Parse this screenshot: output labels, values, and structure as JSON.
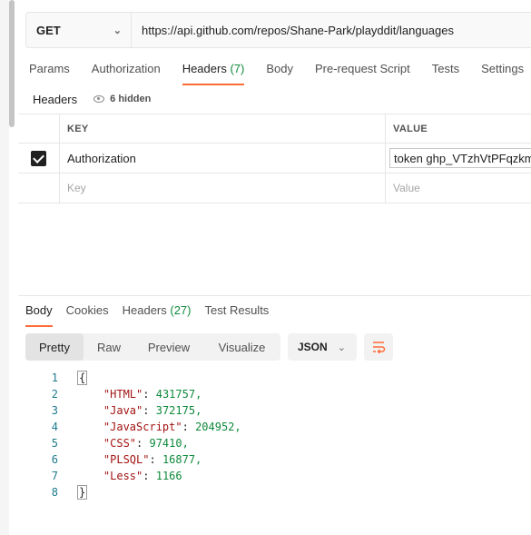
{
  "request": {
    "method": "GET",
    "url": "https://api.github.com/repos/Shane-Park/playddit/languages"
  },
  "request_tabs": [
    {
      "label": "Params"
    },
    {
      "label": "Authorization"
    },
    {
      "label": "Headers",
      "count": "(7)"
    },
    {
      "label": "Body"
    },
    {
      "label": "Pre-request Script"
    },
    {
      "label": "Tests"
    },
    {
      "label": "Settings"
    }
  ],
  "headers_section": {
    "title": "Headers",
    "hidden_label": "6 hidden",
    "columns": {
      "key": "KEY",
      "value": "VALUE"
    },
    "rows": [
      {
        "key": "Authorization",
        "value": "token ghp_VTzhVtPFqzkmS",
        "checked": true
      }
    ],
    "placeholder": {
      "key": "Key",
      "value": "Value"
    }
  },
  "response_tabs": [
    {
      "label": "Body"
    },
    {
      "label": "Cookies"
    },
    {
      "label": "Headers",
      "count": "(27)"
    },
    {
      "label": "Test Results"
    }
  ],
  "view_modes": [
    "Pretty",
    "Raw",
    "Preview",
    "Visualize"
  ],
  "format": "JSON",
  "code_lines": [
    {
      "n": "1",
      "text": "{"
    },
    {
      "n": "2",
      "key": "\"HTML\"",
      "val": "431757,"
    },
    {
      "n": "3",
      "key": "\"Java\"",
      "val": "372175,"
    },
    {
      "n": "4",
      "key": "\"JavaScript\"",
      "val": "204952,"
    },
    {
      "n": "5",
      "key": "\"CSS\"",
      "val": "97410,"
    },
    {
      "n": "6",
      "key": "\"PLSQL\"",
      "val": "16877,"
    },
    {
      "n": "7",
      "key": "\"Less\"",
      "val": "1166"
    },
    {
      "n": "8",
      "text": "}"
    }
  ]
}
